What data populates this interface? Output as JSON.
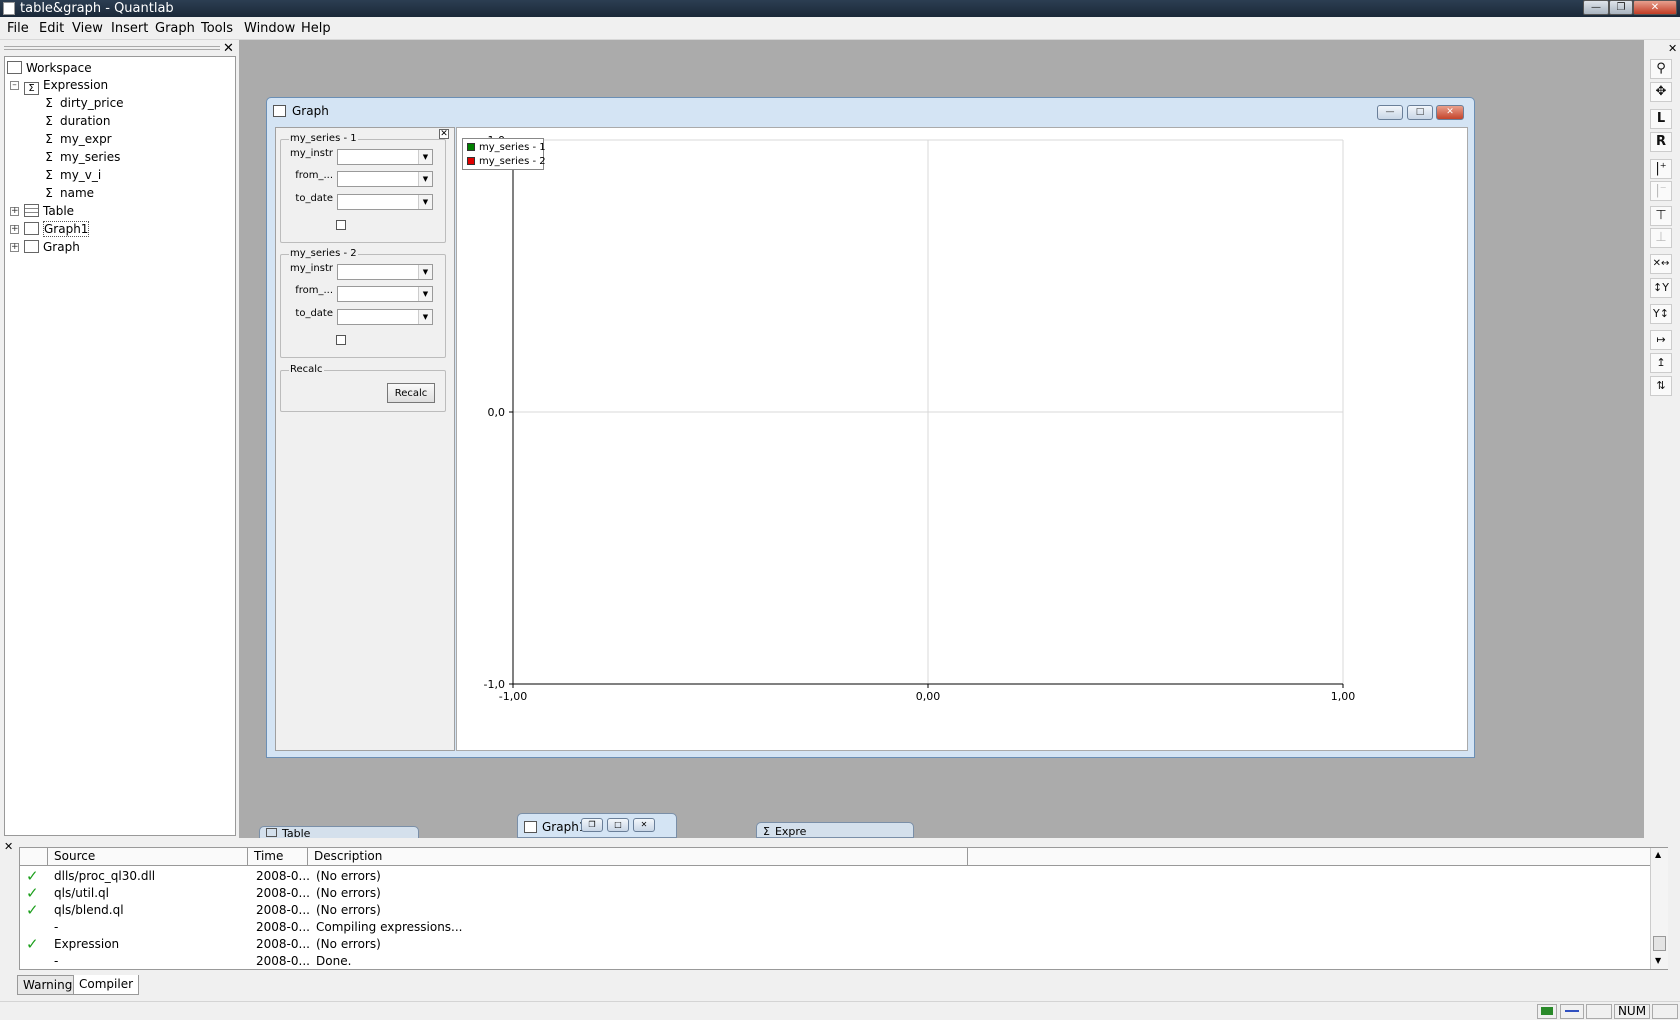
{
  "window": {
    "title": "table&graph - Quantlab"
  },
  "menu": [
    "File",
    "Edit",
    "View",
    "Insert",
    "Graph",
    "Tools",
    "Window",
    "Help"
  ],
  "workspace": {
    "root": "Workspace",
    "expression": "Expression",
    "expressions": [
      "dirty_price",
      "duration",
      "my_expr",
      "my_series",
      "my_v_i",
      "name"
    ],
    "table": "Table",
    "graph1": "Graph1",
    "graph": "Graph"
  },
  "graph_window": {
    "title": "Graph",
    "groups": [
      {
        "label": "my_series - 1",
        "fields": [
          "my_instr",
          "from_...",
          "to_date"
        ]
      },
      {
        "label": "my_series - 2",
        "fields": [
          "my_instr",
          "from_...",
          "to_date"
        ]
      }
    ],
    "recalc_group": "Recalc",
    "recalc_button": "Recalc"
  },
  "chart_data": {
    "type": "line",
    "series": [
      {
        "name": "my_series - 1",
        "color": "#008000",
        "values": []
      },
      {
        "name": "my_series - 2",
        "color": "#e00000",
        "values": []
      }
    ],
    "x_ticks": [
      "-1,00",
      "0,00",
      "1,00"
    ],
    "y_ticks": [
      "-1,0",
      "0,0",
      "1,0"
    ],
    "xlim": [
      -1,
      1
    ],
    "ylim": [
      -1,
      1
    ],
    "grid": true,
    "legend": "top-left"
  },
  "mdi_tabs": {
    "table": "Table",
    "graph1": "Graph1",
    "expr": "Expre"
  },
  "output": {
    "columns": [
      "Source",
      "Time",
      "Description"
    ],
    "rows": [
      {
        "ok": true,
        "source": "dlls/proc_ql30.dll",
        "time": "2008-0...",
        "desc": "(No errors)"
      },
      {
        "ok": true,
        "source": "qls/util.ql",
        "time": "2008-0...",
        "desc": "(No errors)"
      },
      {
        "ok": true,
        "source": "qls/blend.ql",
        "time": "2008-0...",
        "desc": "(No errors)"
      },
      {
        "ok": false,
        "source": "-",
        "time": "2008-0...",
        "desc": "Compiling expressions..."
      },
      {
        "ok": true,
        "source": "Expression",
        "time": "2008-0...",
        "desc": "(No errors)"
      },
      {
        "ok": false,
        "source": "-",
        "time": "2008-0...",
        "desc": "Done."
      }
    ],
    "tabs": [
      "Warnings",
      "Compiler"
    ]
  },
  "status": {
    "num": "NUM"
  }
}
